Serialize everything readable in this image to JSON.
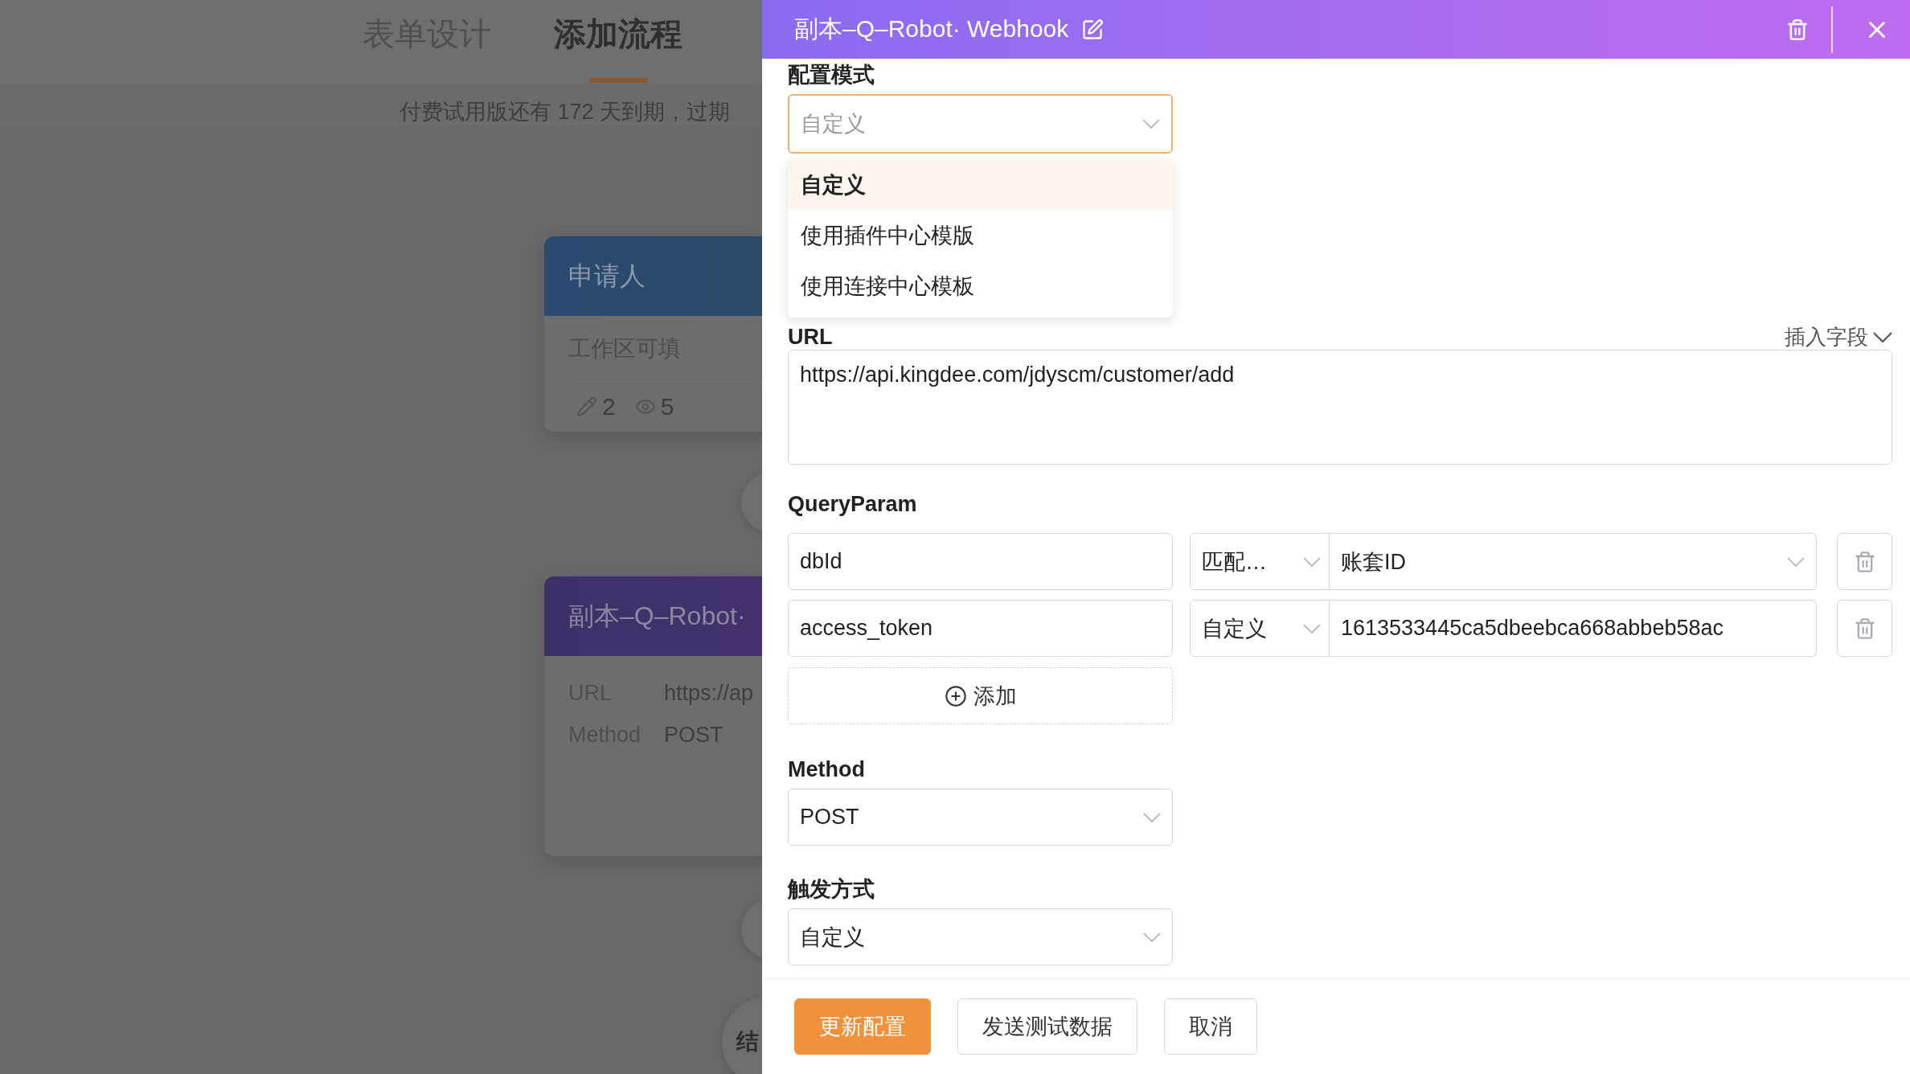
{
  "background": {
    "tabs": [
      {
        "label": "表单设计",
        "selected": false
      },
      {
        "label": "添加流程",
        "selected": true
      }
    ],
    "notice": "付费试用版还有 172 天到期，过期",
    "nodes": [
      {
        "kind": "applicant",
        "title": "申请人",
        "subtitle": "工作区可填",
        "edit_count": "2",
        "view_count": "5"
      },
      {
        "kind": "webhook",
        "title": "副本–Q–Robot·",
        "fields": [
          {
            "label": "URL",
            "value": "https://ap"
          },
          {
            "label": "Method",
            "value": "POST"
          }
        ]
      },
      {
        "kind": "end",
        "title": "结"
      }
    ]
  },
  "drawer": {
    "title": "副本–Q–Robot· Webhook",
    "config_mode": {
      "label": "配置模式",
      "value": "自定义",
      "open": true,
      "options": [
        {
          "label": "自定义",
          "selected": true
        },
        {
          "label": "使用插件中心模版",
          "selected": false
        },
        {
          "label": "使用连接中心模板",
          "selected": false
        }
      ]
    },
    "url": {
      "label": "URL",
      "insert_field": "插入字段",
      "value": "https://api.kingdee.com/jdyscm/customer/add"
    },
    "query_params": {
      "label": "QueryParam",
      "add_label": "添加",
      "rows": [
        {
          "key": "dbId",
          "mode": "匹配…",
          "value": "账套ID",
          "kind": "select"
        },
        {
          "key": "access_token",
          "mode": "自定义",
          "value": "1613533445ca5dbeebca668abbeb58ac",
          "kind": "text"
        }
      ]
    },
    "method": {
      "label": "Method",
      "value": "POST"
    },
    "trigger": {
      "label": "触发方式",
      "value": "自定义"
    },
    "buttons": [
      {
        "label": "更新配置",
        "kind": "primary"
      },
      {
        "label": "发送测试数据",
        "kind": "default"
      },
      {
        "label": "取消",
        "kind": "default"
      }
    ]
  }
}
